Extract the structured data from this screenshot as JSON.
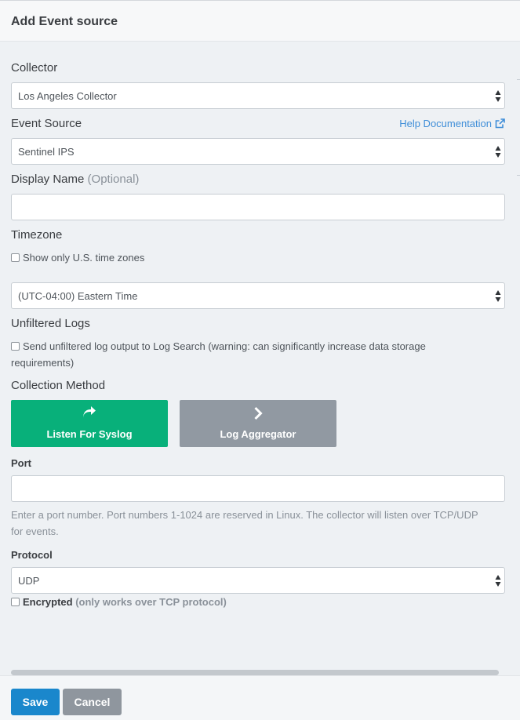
{
  "header": {
    "title": "Add Event source"
  },
  "collector": {
    "label": "Collector",
    "selected": "Los Angeles Collector"
  },
  "event_source": {
    "label": "Event Source",
    "selected": "Sentinel IPS",
    "help_link": "Help Documentation"
  },
  "display_name": {
    "label": "Display Name",
    "optional": "(Optional)",
    "value": ""
  },
  "timezone": {
    "label": "Timezone",
    "us_only_label": "Show only U.S. time zones",
    "selected": "(UTC-04:00) Eastern Time"
  },
  "unfiltered_logs": {
    "label": "Unfiltered Logs",
    "checkbox_line1": "Send unfiltered log output to Log Search (warning: can significantly increase data storage",
    "checkbox_line2": "requirements)"
  },
  "collection_method": {
    "label": "Collection Method",
    "options": [
      {
        "label": "Listen For Syslog",
        "icon": "share-arrow-icon",
        "selected": true
      },
      {
        "label": "Log Aggregator",
        "icon": "chevron-right-icon",
        "selected": false
      }
    ]
  },
  "port": {
    "label": "Port",
    "value": "",
    "hint_line1": "Enter a port number. Port numbers 1-1024 are reserved in Linux. The collector will listen over TCP/UDP",
    "hint_line2": "for events."
  },
  "protocol": {
    "label": "Protocol",
    "selected": "UDP"
  },
  "encrypted": {
    "label": "Encrypted",
    "note": "(only works over TCP protocol)"
  },
  "footer": {
    "save_label": "Save",
    "cancel_label": "Cancel"
  },
  "colors": {
    "primary": "#1a87cc",
    "syslog_selected": "#08b07a",
    "aggregator": "#9199a2",
    "link": "#3f8ed8"
  }
}
